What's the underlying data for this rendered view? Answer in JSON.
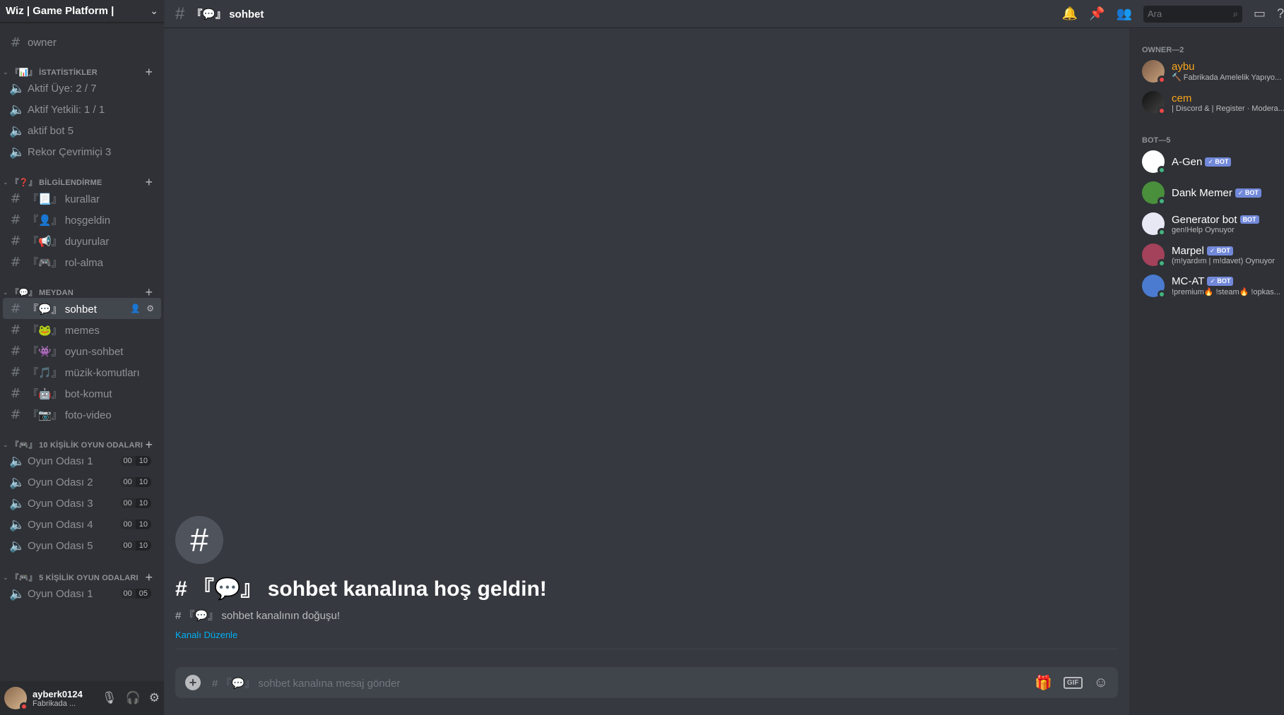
{
  "guild": {
    "name": "Wiz | Game Platform |"
  },
  "colors": {
    "owner_name": "#faa61a",
    "bot_name": "#ffffff",
    "status_dnd": "#f04747",
    "status_online": "#43b581",
    "link": "#00b0f4"
  },
  "channels": {
    "top": {
      "label": "owner"
    },
    "cat_stats": {
      "label": "『📊』 İSTATİSTİKLER",
      "items": [
        "Aktif Üye: 2 / 7",
        "Aktif Yetkili: 1 / 1",
        "aktif bot 5",
        "Rekor Çevrimiçi 3"
      ]
    },
    "cat_info": {
      "label": "『❓』 BİLGİLENDİRME",
      "items": [
        "『📃』 kurallar",
        "『👤』 hoşgeldin",
        "『📢』 duyurular",
        "『🎮』 rol-alma"
      ]
    },
    "cat_meydan": {
      "label": "『💬』 MEYDAN",
      "items": [
        "『💬』 sohbet",
        "『🐸』 memes",
        "『👾』 oyun-sohbet",
        "『🎵』 müzik-komutları",
        "『🤖』 bot-komut",
        "『📷』 foto-video"
      ]
    },
    "cat_10": {
      "label": "『🎮』 10 KİŞİLİK OYUN ODALARI",
      "items": [
        "Oyun Odası 1",
        "Oyun Odası 2",
        "Oyun Odası 3",
        "Oyun Odası 4",
        "Oyun Odası 5"
      ],
      "count": "00",
      "limit": "10"
    },
    "cat_5": {
      "label": "『🎮』 5 KİŞİLİK OYUN ODALARI",
      "items": [
        "Oyun Odası 1"
      ],
      "count": "00",
      "limit": "05"
    }
  },
  "user": {
    "name": "ayberk0124",
    "status": "Fabrikada ..."
  },
  "topbar": {
    "channel": "『💬』 sohbet",
    "search_placeholder": "Ara"
  },
  "welcome": {
    "title": "# 『💬』 sohbet kanalına hoş geldin!",
    "subtitle": "# 『💬』 sohbet kanalının doğuşu!",
    "edit_link": "Kanalı Düzenle"
  },
  "composer": {
    "placeholder": "# 『💬』 sohbet kanalına mesaj gönder",
    "gif": "GIF"
  },
  "members": {
    "owner_role": "OWNER—2",
    "owners": [
      {
        "name": "aybu",
        "activity": "🔨 Fabrikada Amelelik Yapıyo..."
      },
      {
        "name": "cem",
        "activity": "| Discord & | Register · Modera..."
      }
    ],
    "bot_role": "BOT—5",
    "bots": [
      {
        "name": "A-Gen",
        "badge": "✓ BOT",
        "activity": ""
      },
      {
        "name": "Dank Memer",
        "badge": "✓ BOT",
        "activity": ""
      },
      {
        "name": "Generator bot",
        "badge": "BOT",
        "activity": "gen!Help Oynuyor"
      },
      {
        "name": "Marpel",
        "badge": "✓ BOT",
        "activity": "(m!yardım | m!davet) Oynuyor"
      },
      {
        "name": "MC-AT",
        "badge": "✓ BOT",
        "activity": "!premium🔥 !steam🔥 !opkas..."
      }
    ]
  }
}
